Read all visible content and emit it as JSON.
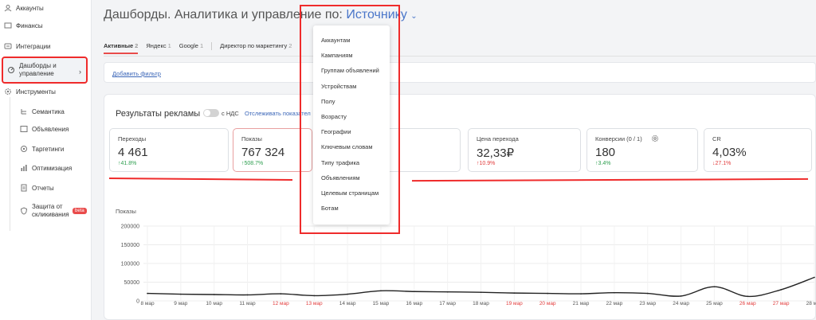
{
  "sidebar": {
    "items": [
      {
        "label": "Аккаунты",
        "icon": "user-icon"
      },
      {
        "label": "Финансы",
        "icon": "wallet-icon"
      },
      {
        "label": "Интеграции",
        "icon": "plug-icon"
      },
      {
        "label": "Дашборды и управление",
        "icon": "dashboard-icon",
        "active": true
      },
      {
        "label": "Инструменты",
        "icon": "gear-icon"
      }
    ],
    "subitems": [
      {
        "label": "Семантика",
        "icon": "semantic-icon"
      },
      {
        "label": "Объявления",
        "icon": "ad-icon"
      },
      {
        "label": "Таргетинги",
        "icon": "target-icon"
      },
      {
        "label": "Оптимизация",
        "icon": "optimize-icon"
      },
      {
        "label": "Отчеты",
        "icon": "report-icon"
      },
      {
        "label": "Защита от скликивания",
        "icon": "shield-icon",
        "badge": "beta"
      }
    ]
  },
  "header": {
    "title_prefix": "Дашборды. Аналитика и управление по:",
    "title_source": "Источнику"
  },
  "tabs": [
    {
      "label": "Активные",
      "count": "2",
      "active": true
    },
    {
      "label": "Яндекс",
      "count": "1"
    },
    {
      "label": "Google",
      "count": "1"
    },
    {
      "label": "Директор по маркетингу",
      "count": "2"
    }
  ],
  "filter": {
    "add_label": "Добавить фильтр"
  },
  "results": {
    "title": "Результаты рекламы",
    "nds_label": "с НДС",
    "track_label": "Отслеживать показател"
  },
  "cards": [
    {
      "label": "Переходы",
      "value": "4 461",
      "delta": "↑41.8%",
      "dir": "up"
    },
    {
      "label": "Показы",
      "value": "767 324",
      "delta": "↑508.7%",
      "dir": "up"
    },
    {
      "label": "Цена перехода",
      "value": "32,33₽",
      "delta": "↑10.9%",
      "dir": "down"
    },
    {
      "label": "Конверсии (0 / 1)",
      "value": "180",
      "delta": "↑3.4%",
      "dir": "up"
    },
    {
      "label": "CR",
      "value": "4,03%",
      "delta": "↓27.1%",
      "dir": "down"
    }
  ],
  "dropdown": {
    "items": [
      "Аккаунтам",
      "Кампаниям",
      "Группам объявлений",
      "Устройствам",
      "Полу",
      "Возрасту",
      "Географии",
      "Ключевым словам",
      "Типу трафика",
      "Объявлениям",
      "Целевым страницам",
      "Ботам"
    ]
  },
  "colors": {
    "accent": "#4a76c9",
    "highlight": "#ef2b2b",
    "up": "#2e9e4f",
    "down": "#e23c3c"
  },
  "chart_data": {
    "type": "line",
    "title": "Показы",
    "categories": [
      "8 мар",
      "9 мар",
      "10 мар",
      "11 мар",
      "12 мар",
      "13 мар",
      "14 мар",
      "15 мар",
      "16 мар",
      "17 мар",
      "18 мар",
      "19 мар",
      "20 мар",
      "21 мар",
      "22 мар",
      "23 мар",
      "24 мар",
      "25 мар",
      "26 мар",
      "27 мар",
      "28 мар"
    ],
    "weekend": [
      false,
      false,
      false,
      false,
      true,
      true,
      false,
      false,
      false,
      false,
      false,
      true,
      true,
      false,
      false,
      false,
      false,
      false,
      true,
      true,
      false
    ],
    "values": [
      20000,
      18000,
      17000,
      16000,
      19000,
      14000,
      18000,
      27000,
      25000,
      24000,
      23000,
      21000,
      20000,
      19000,
      22000,
      20000,
      13000,
      38000,
      12000,
      30000,
      63000
    ],
    "ylim": [
      0,
      200000
    ],
    "yticks": [
      "200000",
      "150000",
      "100000",
      "50000",
      "0"
    ]
  }
}
